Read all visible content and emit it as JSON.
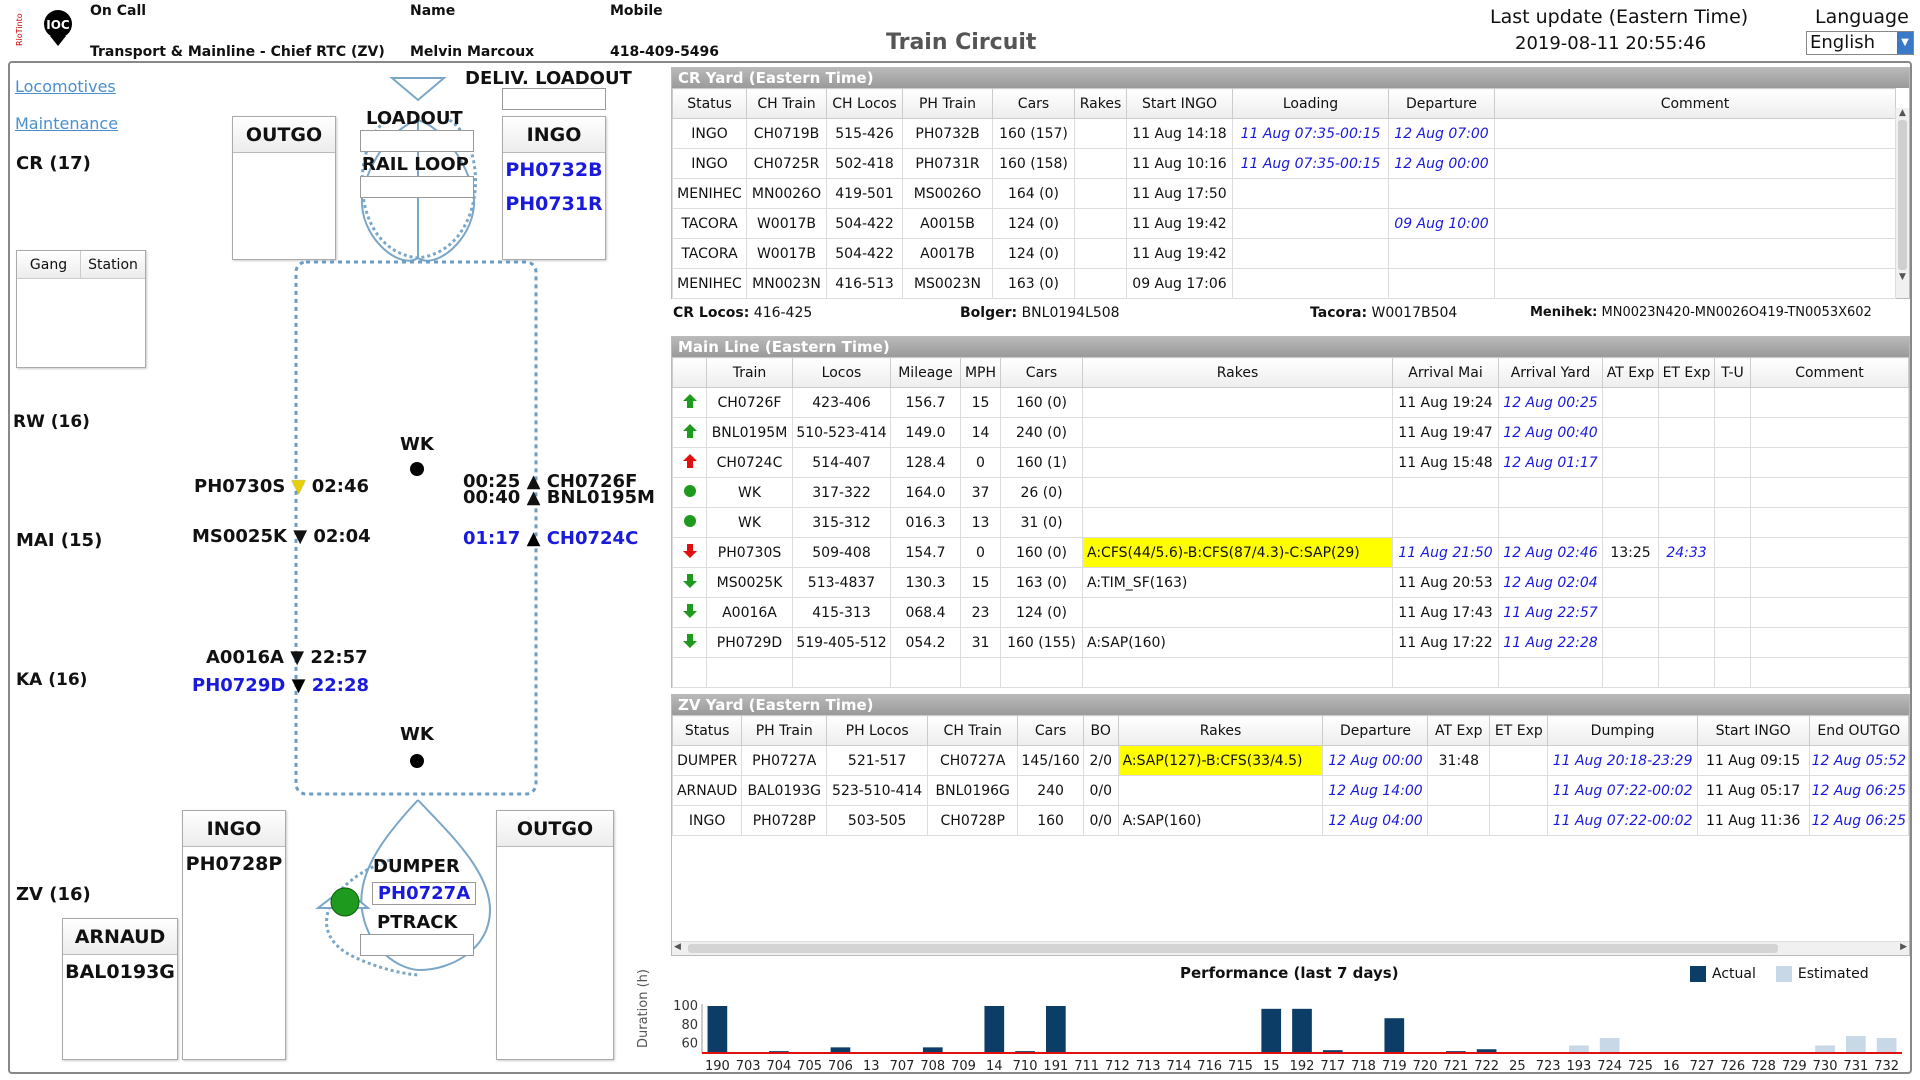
{
  "header": {
    "logo_text": "IOC",
    "logo_sub": "RioTinto",
    "on_call_label": "On Call",
    "on_call_value": "Transport & Mainline - Chief RTC (ZV)",
    "name_label": "Name",
    "name_value": "Melvin Marcoux",
    "mobile_label": "Mobile",
    "mobile_value": "418-409-5496",
    "title": "Train Circuit",
    "last_update_label": "Last update (Eastern Time)",
    "last_update_value": "2019-08-11 20:55:46",
    "language_label": "Language",
    "language_value": "English"
  },
  "left": {
    "links": {
      "locomotives": "Locomotives",
      "maintenance": "Maintenance"
    },
    "sections": {
      "cr": "CR (17)",
      "rw": "RW (16)",
      "mai": "MAI (15)",
      "ka": "KA (16)",
      "zv": "ZV (16)"
    },
    "cr_outgo": "OUTGO",
    "cr_ingo": "INGO",
    "cr_ingo_items": [
      "PH0732B",
      "PH0731R"
    ],
    "deliv_loadout": "DELIV. LOADOUT",
    "loadout": "LOADOUT",
    "rail_loop": "RAIL LOOP",
    "gang_station": {
      "gang": "Gang",
      "station": "Station"
    },
    "wk1": "WK",
    "wk2": "WK",
    "trains_down": [
      {
        "name": "PH0730S",
        "time": "02:46",
        "color": "black",
        "arrow": "yellow"
      },
      {
        "name": "MS0025K",
        "time": "02:04",
        "color": "black",
        "arrow": "black"
      },
      {
        "name": "A0016A",
        "time": "22:57",
        "color": "black",
        "arrow": "black"
      },
      {
        "name": "PH0729D",
        "time": "22:28",
        "color": "blue",
        "arrow": "black"
      }
    ],
    "trains_up": [
      {
        "time": "00:25",
        "name": "CH0726F",
        "color": "black"
      },
      {
        "time": "00:40",
        "name": "BNL0195M",
        "color": "black"
      },
      {
        "time": "01:17",
        "name": "CH0724C",
        "color": "blue"
      }
    ],
    "zv_ingo": "INGO",
    "zv_ingo_items": [
      "PH0728P"
    ],
    "zv_outgo": "OUTGO",
    "arnaud": "ARNAUD",
    "arnaud_items": [
      "BAL0193G"
    ],
    "dumper": "DUMPER",
    "dumper_train": "PH0727A",
    "ptrack": "PTRACK"
  },
  "cr_yard": {
    "title": "CR Yard (Eastern Time)",
    "columns": [
      "Status",
      "CH Train",
      "CH Locos",
      "PH Train",
      "Cars",
      "Rakes",
      "Start INGO",
      "Loading",
      "Departure",
      "Comment"
    ],
    "rows": [
      [
        "INGO",
        "CH0719B",
        "515-426",
        "PH0732B",
        "160 (157)",
        "",
        "11 Aug 14:18",
        "11 Aug 07:35-00:15",
        "12 Aug 07:00",
        ""
      ],
      [
        "INGO",
        "CH0725R",
        "502-418",
        "PH0731R",
        "160 (158)",
        "",
        "11 Aug 10:16",
        "11 Aug 07:35-00:15",
        "12 Aug 00:00",
        ""
      ],
      [
        "MENIHEC",
        "MN0026O",
        "419-501",
        "MS0026O",
        "164 (0)",
        "",
        "11 Aug 17:50",
        "",
        "",
        ""
      ],
      [
        "TACORA",
        "W0017B",
        "504-422",
        "A0015B",
        "124 (0)",
        "",
        "11 Aug 19:42",
        "",
        "09 Aug 10:00",
        ""
      ],
      [
        "TACORA",
        "W0017B",
        "504-422",
        "A0017B",
        "124 (0)",
        "",
        "11 Aug 19:42",
        "",
        "",
        ""
      ],
      [
        "MENIHEC",
        "MN0023N",
        "416-513",
        "MS0023N",
        "163 (0)",
        "",
        "09 Aug 17:06",
        "",
        "",
        ""
      ]
    ],
    "info": {
      "cr_locos_label": "CR Locos:",
      "cr_locos": "416-425",
      "bolger_label": "Bolger:",
      "bolger": "BNL0194L508",
      "tacora_label": "Tacora:",
      "tacora": "W0017B504",
      "menihek_label": "Menihek:",
      "menihek": "MN0023N420-MN0026O419-TN0053X602"
    }
  },
  "main_line": {
    "title": "Main Line (Eastern Time)",
    "columns": [
      "",
      "Train",
      "Locos",
      "Mileage",
      "MPH",
      "Cars",
      "Rakes",
      "Arrival Mai",
      "Arrival Yard",
      "AT Exp",
      "ET Exp",
      "T-U",
      "Comment"
    ],
    "rows": [
      {
        "icon": "up-green",
        "c": [
          "CH0726F",
          "423-406",
          "156.7",
          "15",
          "160 (0)",
          "",
          "11 Aug 19:24",
          "12 Aug 00:25",
          "",
          "",
          "",
          ""
        ]
      },
      {
        "icon": "up-green",
        "c": [
          "BNL0195M",
          "510-523-414",
          "149.0",
          "14",
          "240 (0)",
          "",
          "11 Aug 19:47",
          "12 Aug 00:40",
          "",
          "",
          "",
          ""
        ]
      },
      {
        "icon": "up-red",
        "c": [
          "CH0724C",
          "514-407",
          "128.4",
          "0",
          "160 (1)",
          "",
          "11 Aug 15:48",
          "12 Aug 01:17",
          "",
          "",
          "",
          ""
        ]
      },
      {
        "icon": "dot-green",
        "c": [
          "WK",
          "317-322",
          "164.0",
          "37",
          "26 (0)",
          "",
          "",
          "",
          "",
          "",
          "",
          ""
        ]
      },
      {
        "icon": "dot-green",
        "c": [
          "WK",
          "315-312",
          "016.3",
          "13",
          "31 (0)",
          "",
          "",
          "",
          "",
          "",
          "",
          ""
        ]
      },
      {
        "icon": "down-red",
        "c": [
          "PH0730S",
          "509-408",
          "154.7",
          "0",
          "160 (0)",
          "A:CFS(44/5.6)-B:CFS(87/4.3)-C:SAP(29)",
          "11 Aug 21:50",
          "12 Aug 02:46",
          "13:25",
          "24:33",
          "",
          ""
        ]
      },
      {
        "icon": "down-green",
        "c": [
          "MS0025K",
          "513-4837",
          "130.3",
          "15",
          "163 (0)",
          "A:TIM_SF(163)",
          "11 Aug 20:53",
          "12 Aug 02:04",
          "",
          "",
          "",
          ""
        ]
      },
      {
        "icon": "down-green",
        "c": [
          "A0016A",
          "415-313",
          "068.4",
          "23",
          "124 (0)",
          "",
          "11 Aug 17:43",
          "11 Aug 22:57",
          "",
          "",
          "",
          ""
        ]
      },
      {
        "icon": "down-green",
        "c": [
          "PH0729D",
          "519-405-512",
          "054.2",
          "31",
          "160 (155)",
          "A:SAP(160)",
          "11 Aug 17:22",
          "11 Aug 22:28",
          "",
          "",
          "",
          ""
        ]
      }
    ]
  },
  "zv_yard": {
    "title": "ZV Yard (Eastern Time)",
    "columns": [
      "Status",
      "PH Train",
      "PH Locos",
      "CH Train",
      "Cars",
      "BO",
      "Rakes",
      "Departure",
      "AT Exp",
      "ET Exp",
      "Dumping",
      "Start INGO",
      "End OUTGO"
    ],
    "rows": [
      [
        "DUMPER",
        "PH0727A",
        "521-517",
        "CH0727A",
        "145/160",
        "2/0",
        "A:SAP(127)-B:CFS(33/4.5)",
        "12 Aug 00:00",
        "31:48",
        "",
        "11 Aug 20:18-23:29",
        "11 Aug 09:15",
        "12 Aug 05:52"
      ],
      [
        "ARNAUD",
        "BAL0193G",
        "523-510-414",
        "BNL0196G",
        "240",
        "0/0",
        "",
        "12 Aug 14:00",
        "",
        "",
        "11 Aug 07:22-00:02",
        "11 Aug 05:17",
        "12 Aug 06:25"
      ],
      [
        "INGO",
        "PH0728P",
        "503-505",
        "CH0728P",
        "160",
        "0/0",
        "A:SAP(160)",
        "12 Aug 04:00",
        "",
        "",
        "11 Aug 07:22-00:02",
        "11 Aug 11:36",
        "12 Aug 06:25"
      ]
    ]
  },
  "chart_data": {
    "type": "bar",
    "title": "Performance (last 7 days)",
    "ylabel": "Duration (h)",
    "ylim": [
      50,
      100
    ],
    "yticks": [
      60,
      80,
      100
    ],
    "legend_position": "top-right",
    "series": [
      {
        "name": "Actual",
        "color": "#0b3d66"
      },
      {
        "name": "Estimated",
        "color": "#c8d8e6"
      }
    ],
    "categories": [
      "190",
      "703",
      "704",
      "705",
      "706",
      "13",
      "707",
      "708",
      "709",
      "14",
      "710",
      "191",
      "711",
      "712",
      "713",
      "714",
      "716",
      "715",
      "15",
      "192",
      "717",
      "718",
      "719",
      "720",
      "721",
      "722",
      "25",
      "723",
      "193",
      "724",
      "725",
      "16",
      "727",
      "726",
      "728",
      "729",
      "730",
      "731",
      "732"
    ],
    "actual": [
      100,
      0,
      52,
      0,
      56,
      51,
      0,
      56,
      0,
      100,
      52,
      100,
      0,
      0,
      0,
      0,
      0,
      0,
      97,
      97,
      53,
      0,
      87,
      51,
      52,
      54,
      0,
      0,
      0,
      0,
      0,
      0,
      0,
      0,
      0,
      0,
      0,
      0,
      0
    ],
    "estimated": [
      0,
      0,
      0,
      0,
      0,
      0,
      0,
      0,
      0,
      0,
      0,
      0,
      0,
      0,
      0,
      0,
      0,
      0,
      0,
      0,
      0,
      0,
      0,
      0,
      0,
      0,
      0,
      0,
      58,
      66,
      0,
      0,
      0,
      0,
      0,
      0,
      58,
      68,
      66
    ],
    "threshold": 50
  },
  "colors": {
    "actual": "#0b3d66",
    "estimated": "#c8d8e6",
    "threshold": "#e01010",
    "link": "#4a8fd0",
    "highlight": "#ffff00"
  }
}
